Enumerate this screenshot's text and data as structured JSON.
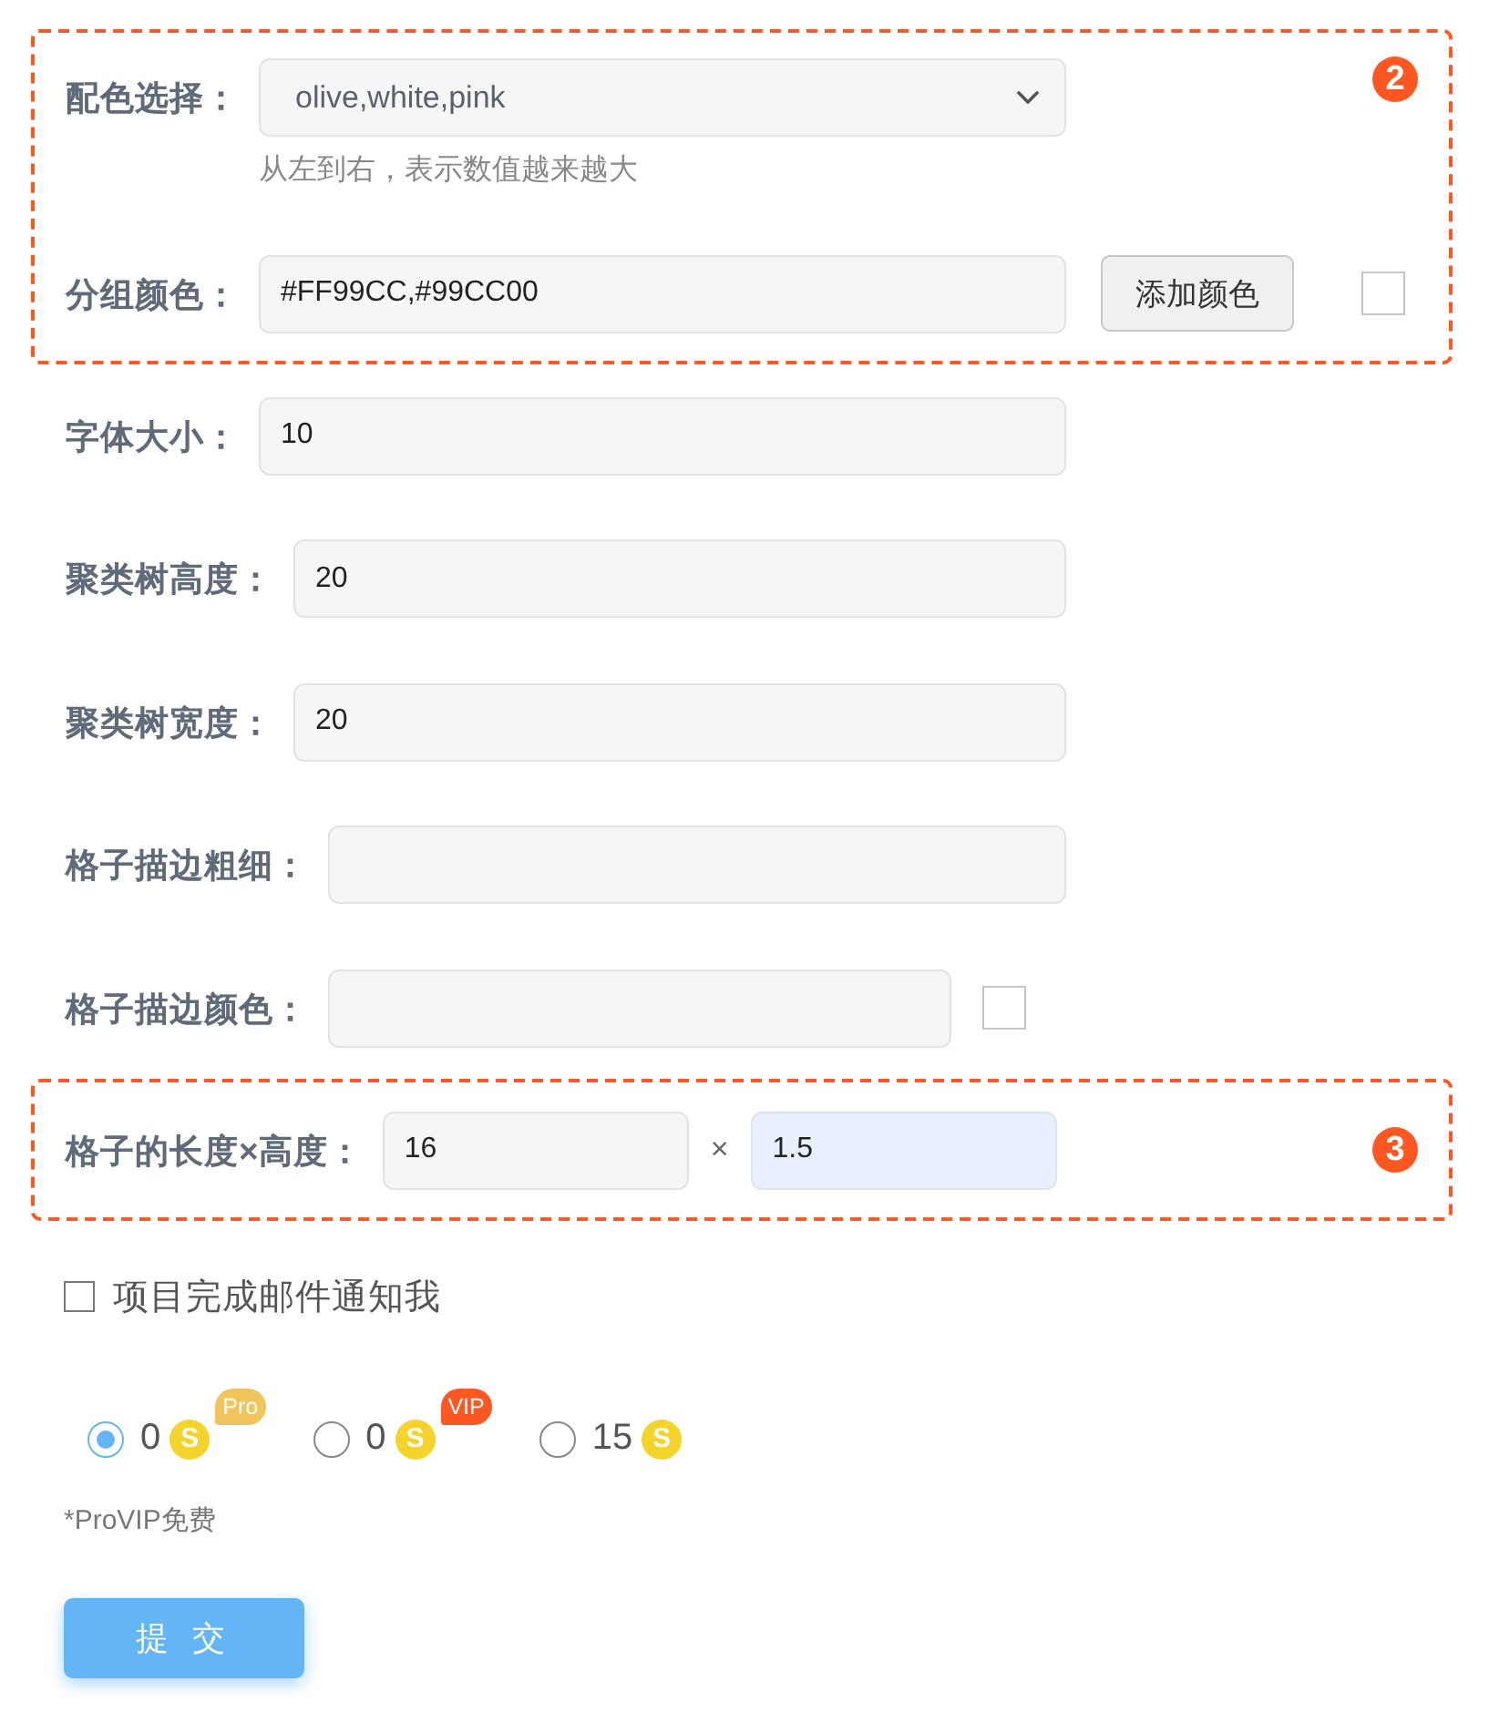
{
  "groups": [
    {
      "badge": "2",
      "fields": [
        {
          "kind": "select",
          "label": "配色选择：",
          "value": "olive,white,pink",
          "hint": "从左到右，表示数值越来越大"
        },
        {
          "kind": "color_list",
          "label": "分组颜色：",
          "value": "#FF99CC,#99CC00",
          "button": "添加颜色"
        }
      ]
    },
    {
      "fields": [
        {
          "kind": "text",
          "label": "字体大小：",
          "value": "10"
        },
        {
          "kind": "text",
          "label": "聚类树高度：",
          "value": "20"
        },
        {
          "kind": "text",
          "label": "聚类树宽度：",
          "value": "20"
        },
        {
          "kind": "text",
          "label": "格子描边粗细："
        },
        {
          "kind": "color",
          "label": "格子描边颜色："
        }
      ]
    },
    {
      "badge": "3",
      "fields": [
        {
          "kind": "size",
          "label": "格子的长度×高度：",
          "separator": "×",
          "inputs": [
            {
              "value": "16",
              "autofilled": false
            },
            {
              "value": "1.5",
              "autofilled": true
            }
          ]
        }
      ]
    }
  ],
  "notify": {
    "label": "项目完成邮件通知我",
    "checked": false
  },
  "plans": [
    {
      "price": "0",
      "coin": "S",
      "tag": {
        "text": "Pro",
        "color": "#f2c55c"
      },
      "selected": true
    },
    {
      "price": "0",
      "coin": "S",
      "tag": {
        "text": "VIP",
        "color": "#ff5722"
      },
      "selected": false
    },
    {
      "price": "15",
      "coin": "S",
      "selected": false
    }
  ],
  "plan_note": "*ProVIP免费",
  "submit": "提 交"
}
